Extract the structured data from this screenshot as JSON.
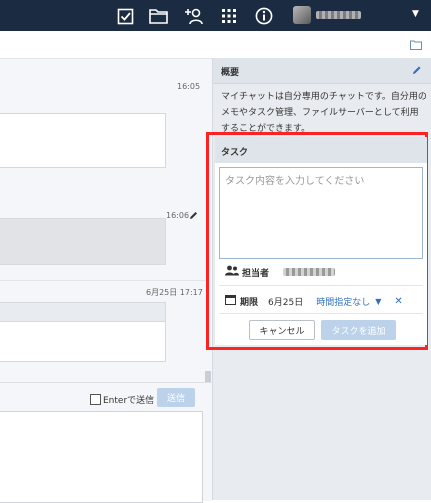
{
  "topbar": {
    "icons": [
      "task-check-icon",
      "folder-icon",
      "add-contact-icon",
      "apps-grid-icon",
      "info-icon"
    ],
    "bg": "#1b2b42"
  },
  "chat": {
    "timestamps": [
      "16:05",
      "16:06",
      "6月25日 17:17"
    ],
    "composer": {
      "enter_label": "Enterで送信",
      "send_label": "送信"
    }
  },
  "sidebar": {
    "overview_title": "概要",
    "overview_text": "マイチャットは自分専用のチャットです。自分用のメモやタスク管理、ファイルサーバーとして利用することができます。"
  },
  "task_form": {
    "title": "タスク",
    "placeholder": "タスク内容を入力してください",
    "assignee_label": "担当者",
    "deadline_label": "期限",
    "deadline_date": "6月25日",
    "time_option": "時間指定なし",
    "cancel_label": "キャンセル",
    "add_label": "タスクを追加",
    "highlight_color": "#f22222"
  }
}
